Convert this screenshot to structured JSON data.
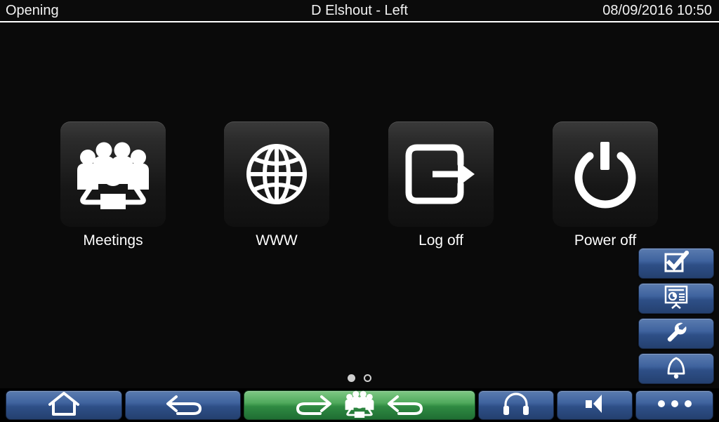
{
  "titlebar": {
    "status": "Opening",
    "user": "D Elshout - Left",
    "datetime": "08/09/2016 10:50"
  },
  "home_screen": {
    "tiles": [
      {
        "label": "Meetings",
        "icon": "meetings-icon"
      },
      {
        "label": "WWW",
        "icon": "globe-icon"
      },
      {
        "label": "Log off",
        "icon": "logoff-icon"
      },
      {
        "label": "Power off",
        "icon": "power-icon"
      }
    ],
    "page_indicator": {
      "pages": 2,
      "active": 1
    }
  },
  "side_buttons": [
    {
      "name": "vote-button",
      "icon": "checkbox-checked-icon"
    },
    {
      "name": "presentation-button",
      "icon": "presentation-screen-icon"
    },
    {
      "name": "settings-button",
      "icon": "wrench-icon"
    },
    {
      "name": "alert-button",
      "icon": "bell-icon"
    }
  ],
  "toolbar": [
    {
      "name": "home-button",
      "icon": "home-icon",
      "style": "blue"
    },
    {
      "name": "back-button",
      "icon": "arrow-back-icon",
      "style": "blue"
    },
    {
      "name": "meeting-nav-button",
      "icon": "forward-meetings-back-icons",
      "style": "green"
    },
    {
      "name": "headset-button",
      "icon": "headphones-icon",
      "style": "blue"
    },
    {
      "name": "volume-button",
      "icon": "speaker-icon",
      "style": "blue"
    },
    {
      "name": "more-button",
      "icon": "ellipsis-icon",
      "style": "blue"
    }
  ],
  "colors": {
    "background": "#0a0a0a",
    "titlebar_text": "#f2f2f2",
    "button_blue": "#3f639e",
    "button_green": "#4fa95c",
    "tile_top": "#3a3a3a",
    "tile_bottom": "#101010"
  }
}
